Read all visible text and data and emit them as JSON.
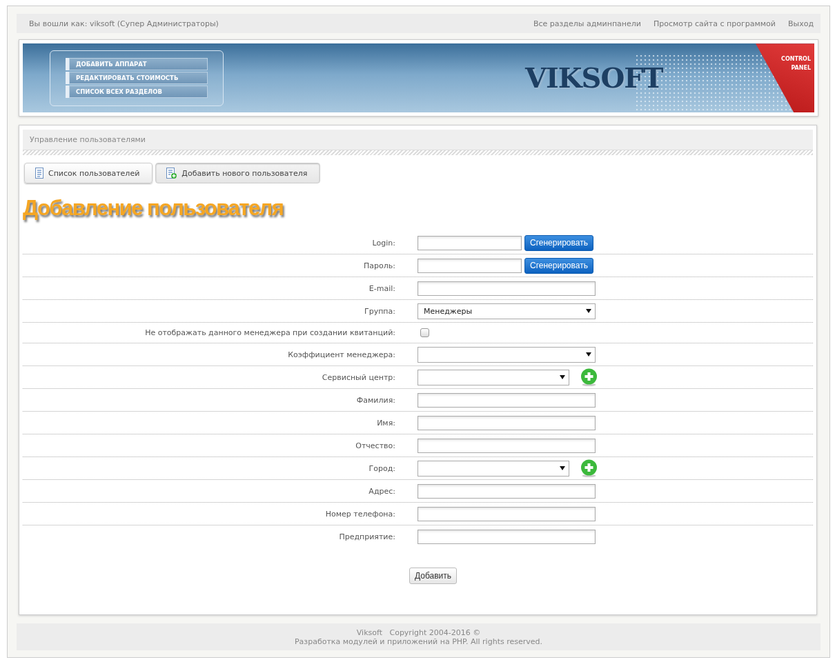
{
  "top_bar": {
    "user_text": "Вы вошли как: viksoft (Супер Администраторы)",
    "links": [
      "Все разделы админпанели",
      "Просмотр сайта с программой",
      "Выход"
    ]
  },
  "banner": {
    "menu": [
      "ДОБАВИТЬ АППАРАТ",
      "РЕДАКТИРОВАТЬ СТОИМОСТЬ",
      "СПИСОК ВСЕХ РАЗДЕЛОВ"
    ],
    "logo": "VIKSOFT",
    "badge_lines": [
      "CONTROL",
      "PANEL"
    ]
  },
  "section": {
    "title": "Управление пользователями"
  },
  "tabs": [
    {
      "label": "Список пользователей",
      "kind": "list",
      "selected": false
    },
    {
      "label": "Добавить нового пользователя",
      "kind": "add",
      "selected": true
    }
  ],
  "heading": "Добавление пользователя",
  "form": {
    "fields": [
      {
        "kind": "generate",
        "label": "Login:",
        "button": "Сгенерировать"
      },
      {
        "kind": "generate",
        "label": "Пароль:",
        "button": "Сгенерировать"
      },
      {
        "kind": "text",
        "label": "E-mail:"
      },
      {
        "kind": "select",
        "label": "Группа:",
        "value": "Менеджеры"
      },
      {
        "kind": "checkbox",
        "label": "Не отображать данного менеджера при создании квитанций:",
        "checked": false
      },
      {
        "kind": "select",
        "label": "Коэффициент менеджера:"
      },
      {
        "kind": "select_add",
        "label": "Сервисный центр:"
      },
      {
        "kind": "text",
        "label": "Фамилия:"
      },
      {
        "kind": "text",
        "label": "Имя:"
      },
      {
        "kind": "text",
        "label": "Отчество:"
      },
      {
        "kind": "select_add",
        "label": "Город:"
      },
      {
        "kind": "text",
        "label": "Адрес:"
      },
      {
        "kind": "text",
        "label": "Номер телефона:"
      },
      {
        "kind": "text",
        "label": "Предприятие:"
      }
    ],
    "submit": "Добавить"
  },
  "footer": {
    "lines": [
      "Viksoft   Copyright 2004-2016 ©",
      "Разработка модулей и приложений на PHP. All rights reserved."
    ]
  }
}
